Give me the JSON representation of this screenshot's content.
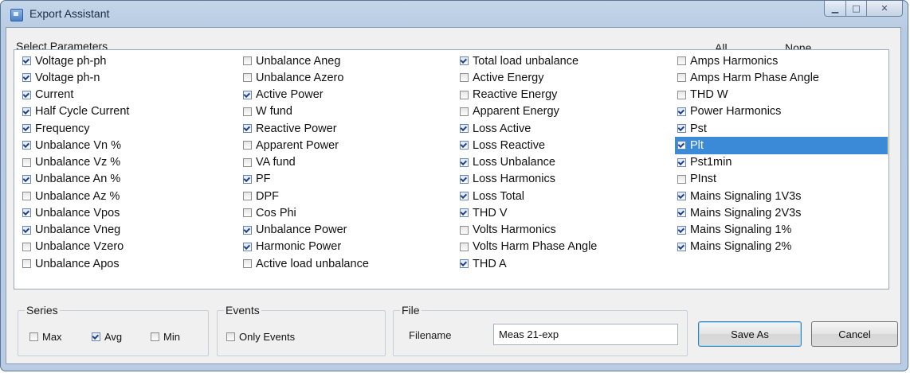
{
  "window": {
    "title": "Export Assistant",
    "minimize_glyph": "▁",
    "maximize_glyph": "□",
    "close_glyph": "✕"
  },
  "params": {
    "title": "Select Parameters",
    "all_label": "All",
    "none_label": "None",
    "columns": [
      [
        {
          "label": "Voltage ph-ph",
          "checked": true
        },
        {
          "label": "Voltage ph-n",
          "checked": true
        },
        {
          "label": "Current",
          "checked": true
        },
        {
          "label": "Half Cycle Current",
          "checked": true
        },
        {
          "label": "Frequency",
          "checked": true
        },
        {
          "label": "Unbalance Vn %",
          "checked": true
        },
        {
          "label": "Unbalance Vz %",
          "checked": false
        },
        {
          "label": "Unbalance An %",
          "checked": true
        },
        {
          "label": "Unbalance Az %",
          "checked": false
        },
        {
          "label": "Unbalance Vpos",
          "checked": true
        },
        {
          "label": "Unbalance Vneg",
          "checked": true
        },
        {
          "label": "Unbalance Vzero",
          "checked": false
        },
        {
          "label": "Unbalance Apos",
          "checked": false
        }
      ],
      [
        {
          "label": "Unbalance Aneg",
          "checked": false
        },
        {
          "label": "Unbalance Azero",
          "checked": false
        },
        {
          "label": "Active Power",
          "checked": true
        },
        {
          "label": "W fund",
          "checked": false
        },
        {
          "label": "Reactive Power",
          "checked": true
        },
        {
          "label": "Apparent Power",
          "checked": false
        },
        {
          "label": "VA fund",
          "checked": false
        },
        {
          "label": "PF",
          "checked": true
        },
        {
          "label": "DPF",
          "checked": false
        },
        {
          "label": "Cos Phi",
          "checked": false
        },
        {
          "label": "Unbalance Power",
          "checked": true
        },
        {
          "label": "Harmonic Power",
          "checked": true
        },
        {
          "label": "Active load unbalance",
          "checked": false
        }
      ],
      [
        {
          "label": "Total load unbalance",
          "checked": true
        },
        {
          "label": "Active Energy",
          "checked": false
        },
        {
          "label": "Reactive Energy",
          "checked": false
        },
        {
          "label": "Apparent Energy",
          "checked": false
        },
        {
          "label": "Loss Active",
          "checked": true
        },
        {
          "label": "Loss Reactive",
          "checked": true
        },
        {
          "label": "Loss Unbalance",
          "checked": true
        },
        {
          "label": "Loss Harmonics",
          "checked": true
        },
        {
          "label": "Loss Total",
          "checked": true
        },
        {
          "label": "THD V",
          "checked": true
        },
        {
          "label": "Volts Harmonics",
          "checked": false
        },
        {
          "label": "Volts Harm Phase Angle",
          "checked": false
        },
        {
          "label": "THD A",
          "checked": true
        }
      ],
      [
        {
          "label": "Amps Harmonics",
          "checked": false
        },
        {
          "label": "Amps Harm Phase Angle",
          "checked": false
        },
        {
          "label": "THD W",
          "checked": false
        },
        {
          "label": "Power Harmonics",
          "checked": true
        },
        {
          "label": "Pst",
          "checked": true
        },
        {
          "label": "Plt",
          "checked": true,
          "selected": true
        },
        {
          "label": "Pst1min",
          "checked": true
        },
        {
          "label": "PInst",
          "checked": false
        },
        {
          "label": "Mains Signaling 1V3s",
          "checked": true
        },
        {
          "label": "Mains Signaling 2V3s",
          "checked": true
        },
        {
          "label": "Mains Signaling 1%",
          "checked": true
        },
        {
          "label": "Mains Signaling 2%",
          "checked": true
        }
      ]
    ]
  },
  "series": {
    "title": "Series",
    "options": [
      {
        "label": "Max",
        "checked": false
      },
      {
        "label": "Avg",
        "checked": true
      },
      {
        "label": "Min",
        "checked": false
      }
    ]
  },
  "events": {
    "title": "Events",
    "only_events_label": "Only Events",
    "only_events_checked": false
  },
  "file": {
    "title": "File",
    "filename_label": "Filename",
    "filename_value": "Meas 21-exp"
  },
  "buttons": {
    "save_as": "Save As",
    "cancel": "Cancel"
  }
}
